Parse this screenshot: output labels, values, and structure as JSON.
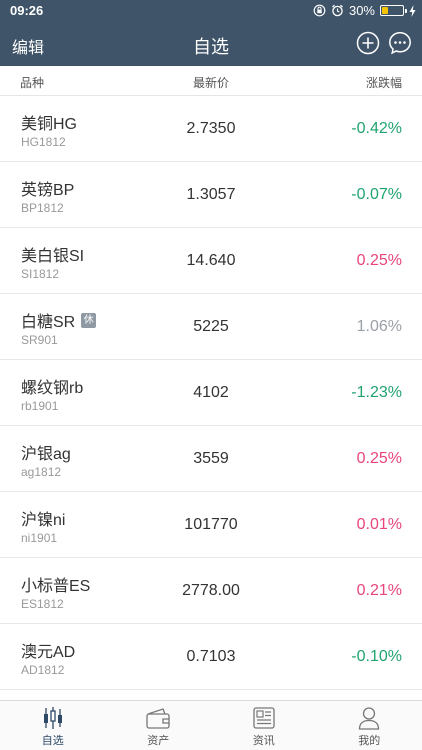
{
  "status": {
    "time": "09:26",
    "battery": "30%",
    "battery_level": 0.3
  },
  "nav": {
    "left_label": "编辑",
    "title": "自选"
  },
  "columns": {
    "name": "品种",
    "price": "最新价",
    "change": "涨跌幅"
  },
  "rows": [
    {
      "name": "美铜HG",
      "code": "HG1812",
      "price": "2.7350",
      "change": "-0.42%",
      "dir": "down",
      "badge": ""
    },
    {
      "name": "英镑BP",
      "code": "BP1812",
      "price": "1.3057",
      "change": "-0.07%",
      "dir": "down",
      "badge": ""
    },
    {
      "name": "美白银SI",
      "code": "SI1812",
      "price": "14.640",
      "change": "0.25%",
      "dir": "up",
      "badge": ""
    },
    {
      "name": "白糖SR",
      "code": "SR901",
      "price": "5225",
      "change": "1.06%",
      "dir": "flat",
      "badge": "休"
    },
    {
      "name": "螺纹钢rb",
      "code": "rb1901",
      "price": "4102",
      "change": "-1.23%",
      "dir": "down",
      "badge": ""
    },
    {
      "name": "沪银ag",
      "code": "ag1812",
      "price": "3559",
      "change": "0.25%",
      "dir": "up",
      "badge": ""
    },
    {
      "name": "沪镍ni",
      "code": "ni1901",
      "price": "101770",
      "change": "0.01%",
      "dir": "up",
      "badge": ""
    },
    {
      "name": "小标普ES",
      "code": "ES1812",
      "price": "2778.00",
      "change": "0.21%",
      "dir": "up",
      "badge": ""
    },
    {
      "name": "澳元AD",
      "code": "AD1812",
      "price": "0.7103",
      "change": "-0.10%",
      "dir": "down",
      "badge": ""
    }
  ],
  "tabs": [
    {
      "label": "自选",
      "icon": "candlestick-icon",
      "active": true
    },
    {
      "label": "资产",
      "icon": "wallet-icon",
      "active": false
    },
    {
      "label": "资讯",
      "icon": "news-icon",
      "active": false
    },
    {
      "label": "我的",
      "icon": "profile-icon",
      "active": false
    }
  ],
  "colors": {
    "header_bg": "#3f5468",
    "down": "#1fa36f",
    "up": "#e8457a",
    "flat": "#9aa0a6"
  }
}
